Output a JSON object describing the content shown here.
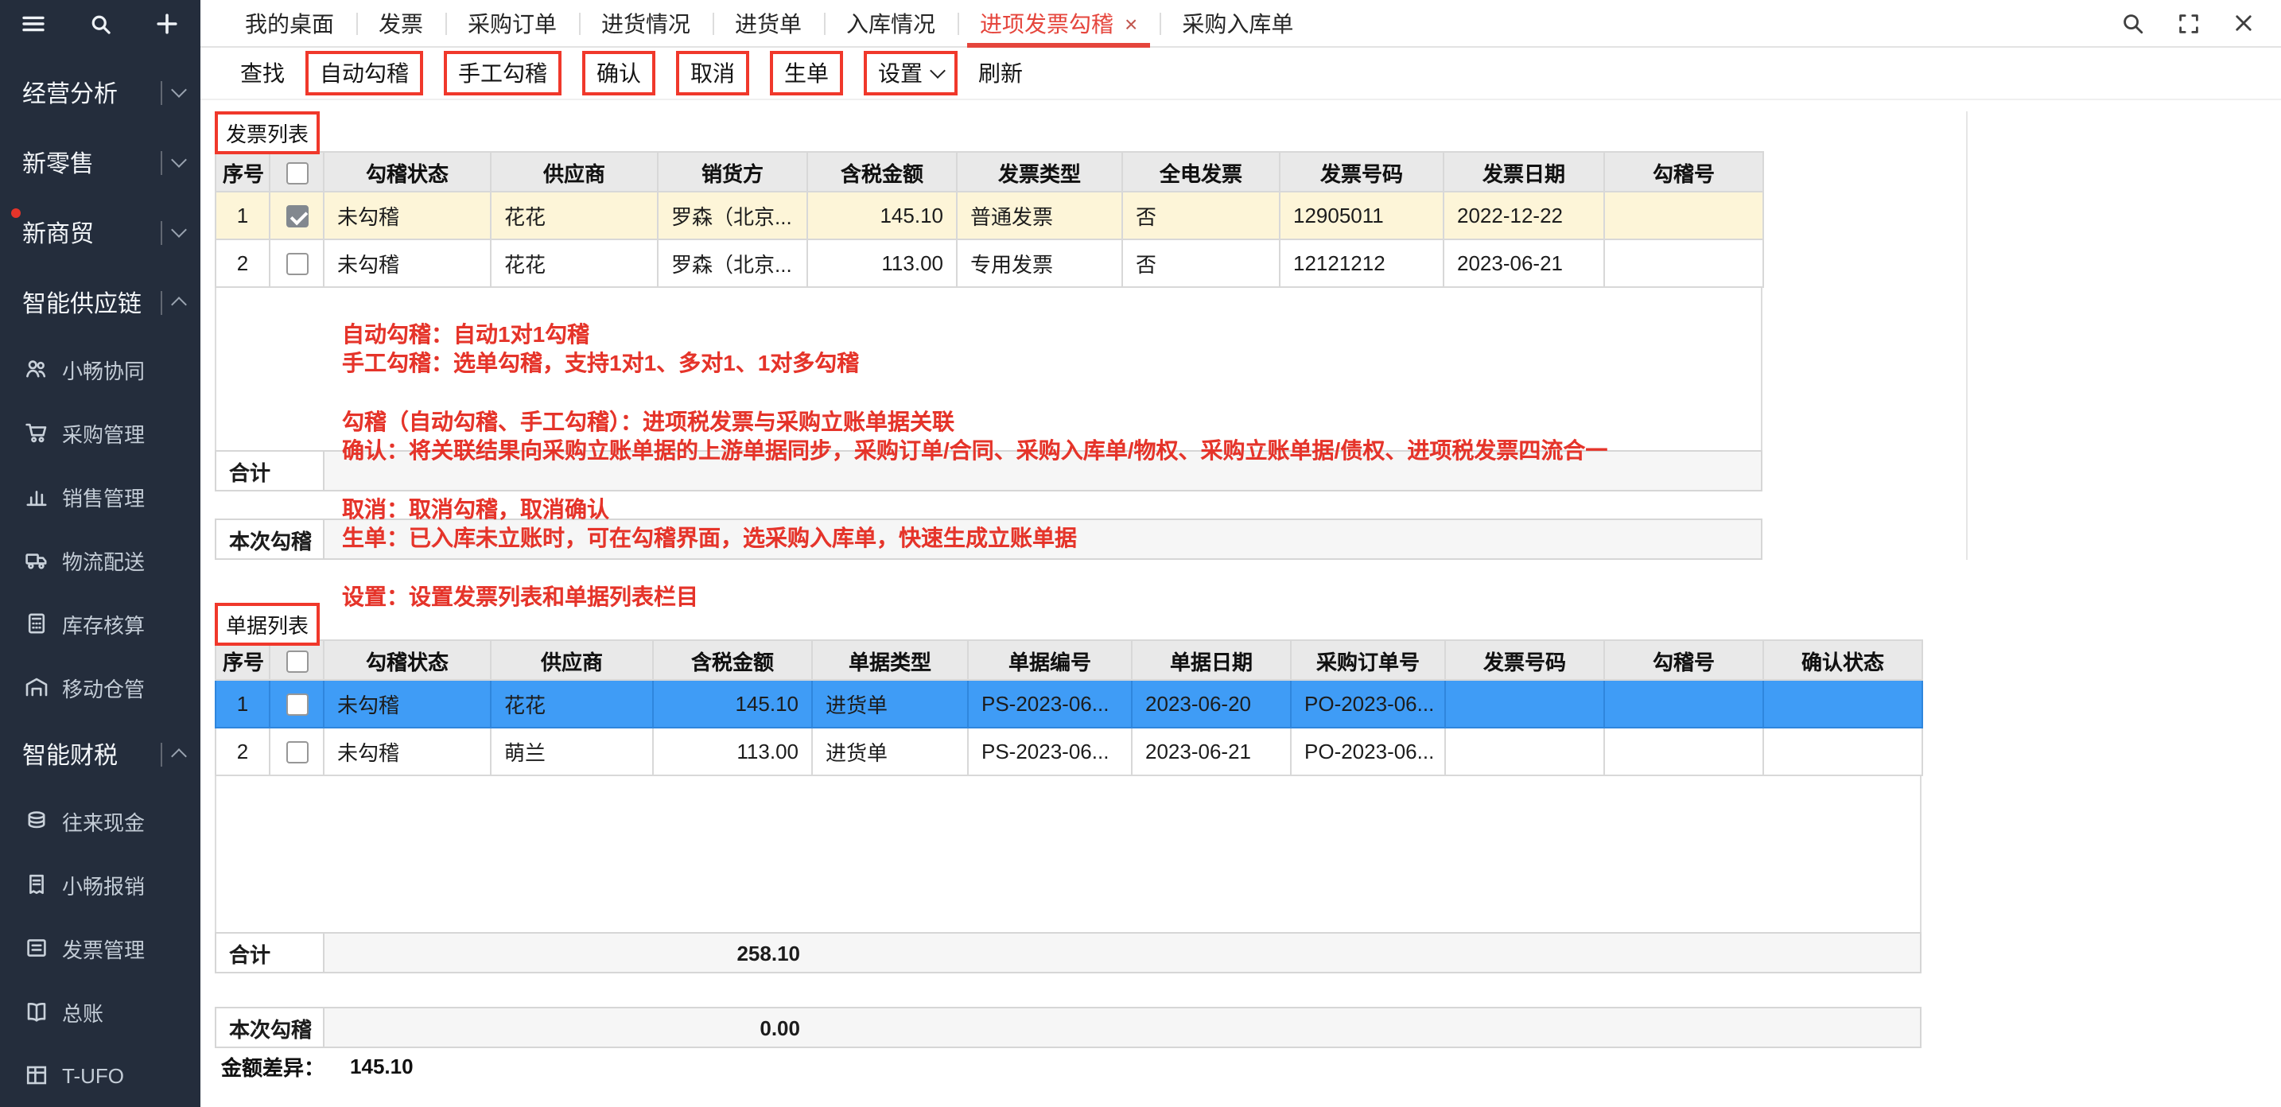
{
  "colors": {
    "accent_red": "#f0382b",
    "annotation_red": "#e5342a",
    "tab_active_red": "#e5453c",
    "selected_row_blue": "#3f9cf6",
    "highlight_row_yellow": "#fdf5d8",
    "sidebar_bg": "#242d3c"
  },
  "tabs": {
    "items": [
      {
        "label": "我的桌面",
        "active": false
      },
      {
        "label": "发票",
        "active": false
      },
      {
        "label": "采购订单",
        "active": false
      },
      {
        "label": "进货情况",
        "active": false
      },
      {
        "label": "进货单",
        "active": false
      },
      {
        "label": "入库情况",
        "active": false
      },
      {
        "label": "进项发票勾稽",
        "active": true,
        "close": "×"
      },
      {
        "label": "采购入库单",
        "active": false
      }
    ]
  },
  "toolbar": {
    "find": "查找",
    "auto_match": "自动勾稽",
    "manual_match": "手工勾稽",
    "confirm": "确认",
    "cancel": "取消",
    "generate": "生单",
    "settings": "设置",
    "refresh": "刷新"
  },
  "sidebar": {
    "sections": [
      {
        "label": "经营分析",
        "state": "collapsed"
      },
      {
        "label": "新零售",
        "state": "collapsed"
      },
      {
        "label": "新商贸",
        "state": "collapsed",
        "badge": true
      },
      {
        "label": "智能供应链",
        "state": "expanded"
      },
      {
        "label": "智能财税",
        "state": "expanded"
      }
    ],
    "supply_items": [
      "小畅协同",
      "采购管理",
      "销售管理",
      "物流配送",
      "库存核算",
      "移动仓管"
    ],
    "finance_items": [
      "往来现金",
      "小畅报销",
      "发票管理",
      "总账",
      "T-UFO"
    ]
  },
  "invoice_list": {
    "title": "发票列表",
    "headers": [
      "序号",
      "",
      "勾稽状态",
      "供应商",
      "销货方",
      "含税金额",
      "发票类型",
      "全电发票",
      "发票号码",
      "发票日期",
      "勾稽号"
    ],
    "rows": [
      {
        "seq": "1",
        "checked": true,
        "status": "未勾稽",
        "supplier": "花花",
        "seller": "罗森（北京...",
        "amount": "145.10",
        "type": "普通发票",
        "e_invoice": "否",
        "number": "12905011",
        "date": "2022-12-22",
        "match_no": ""
      },
      {
        "seq": "2",
        "checked": false,
        "status": "未勾稽",
        "supplier": "花花",
        "seller": "罗森（北京...",
        "amount": "113.00",
        "type": "专用发票",
        "e_invoice": "否",
        "number": "12121212",
        "date": "2023-06-21",
        "match_no": ""
      }
    ],
    "total_label": "合计",
    "current_label": "本次勾稽"
  },
  "annotations": {
    "lines": [
      "自动勾稽：自动1对1勾稽",
      "手工勾稽：选单勾稽，支持1对1、多对1、1对多勾稽",
      "勾稽（自动勾稽、手工勾稽）：进项税发票与采购立账单据关联",
      "确认：将关联结果向采购立账单据的上游单据同步，采购订单/合同、采购入库单/物权、采购立账单据/债权、进项税发票四流合一",
      "取消：取消勾稽，取消确认",
      "生单：已入库未立账时，可在勾稽界面，选采购入库单，快速生成立账单据",
      "设置：设置发票列表和单据列表栏目"
    ]
  },
  "doc_list": {
    "title": "单据列表",
    "headers": [
      "序号",
      "",
      "勾稽状态",
      "供应商",
      "含税金额",
      "单据类型",
      "单据编号",
      "单据日期",
      "采购订单号",
      "发票号码",
      "勾稽号",
      "确认状态"
    ],
    "rows": [
      {
        "seq": "1",
        "checked": false,
        "status": "未勾稽",
        "supplier": "花花",
        "amount": "145.10",
        "type": "进货单",
        "number": "PS-2023-06...",
        "date": "2023-06-20",
        "po": "PO-2023-06...",
        "invoice_no": "",
        "match_no": "",
        "confirm_status": ""
      },
      {
        "seq": "2",
        "checked": false,
        "status": "未勾稽",
        "supplier": "萌兰",
        "amount": "113.00",
        "type": "进货单",
        "number": "PS-2023-06...",
        "date": "2023-06-21",
        "po": "PO-2023-06...",
        "invoice_no": "",
        "match_no": "",
        "confirm_status": ""
      }
    ],
    "total_label": "合计",
    "total_amount": "258.10",
    "current_label": "本次勾稽",
    "current_amount": "0.00",
    "diff_label": "金额差异：",
    "diff_value": "145.10"
  }
}
